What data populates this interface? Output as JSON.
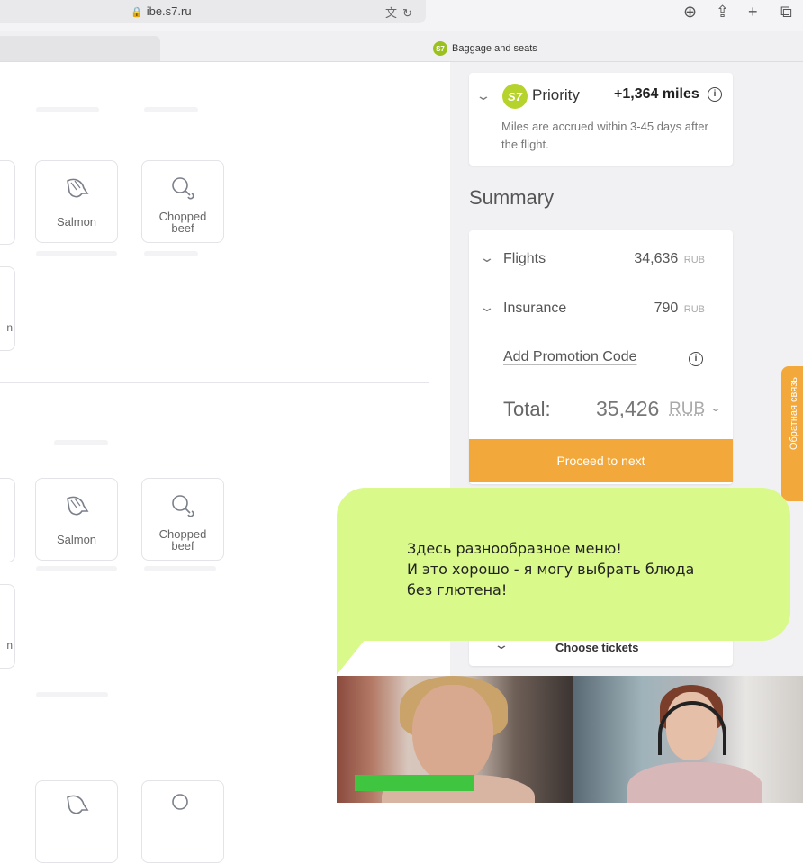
{
  "browser": {
    "url": "ibe.s7.ru",
    "tab_title": "Baggage and seats",
    "tab_logo": "S7"
  },
  "meals": {
    "group1": [
      {
        "label_line1": "Salmon",
        "label_line2": "",
        "icon": "fish-icon"
      },
      {
        "label_line1": "Chopped",
        "label_line2": "beef",
        "icon": "chicken-leg-icon"
      }
    ],
    "group2": [
      {
        "label_line1": "Salmon",
        "label_line2": "",
        "icon": "fish-icon"
      },
      {
        "label_line1": "Chopped",
        "label_line2": "beef",
        "icon": "chicken-leg-icon"
      }
    ],
    "edge_letter": "n"
  },
  "priority": {
    "logo": "S7",
    "title": "Priority",
    "miles": "+1,364 miles",
    "note": "Miles are accrued within 3-45 days after the flight."
  },
  "summary": {
    "title": "Summary",
    "flights_label": "Flights",
    "flights_value": "34,636",
    "insurance_label": "Insurance",
    "insurance_value": "790",
    "currency": "RUB",
    "promo_label": "Add Promotion Code",
    "total_label": "Total:",
    "total_value": "35,426",
    "total_currency": "RUB",
    "proceed_label": "Proceed to next",
    "choose_tickets_label": "Choose tickets"
  },
  "feedback_tab": "Обратная связь",
  "bubble": {
    "line1": "Здесь разнообразное меню!",
    "line2": "И это хорошо - я могу выбрать блюда",
    "line3": "без глютена!"
  },
  "colors": {
    "accent_orange": "#f2a83a",
    "s7_green": "#b6d22c",
    "bubble_green": "#d9f98a",
    "speaking_indicator": "#3fc53f"
  }
}
